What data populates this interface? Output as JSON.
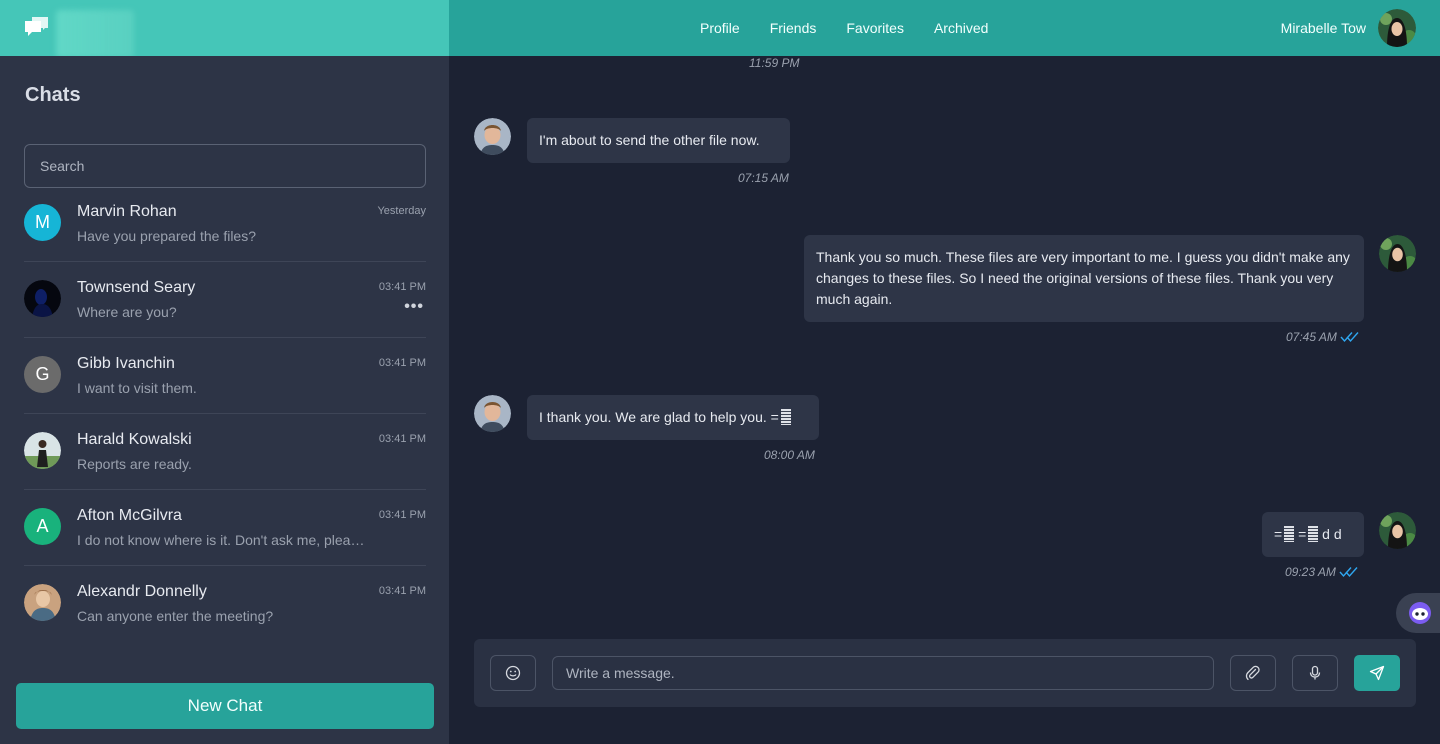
{
  "header": {
    "nav": [
      "Profile",
      "Friends",
      "Favorites",
      "Archived"
    ],
    "user_name": "Mirabelle Tow",
    "accent": "#27a39a",
    "brand_color": "#45c6b8"
  },
  "sidebar": {
    "title": "Chats",
    "search_placeholder": "Search",
    "chats": [
      {
        "name": "Marvin Rohan",
        "message": "Have you prepared the files?",
        "time": "Yesterday",
        "avatar": "M",
        "avatar_color": "#16b5d6"
      },
      {
        "name": "Townsend Seary",
        "message": "Where are you?",
        "time": "03:41 PM",
        "avatar_icon": "photo-avatar",
        "more": "•••"
      },
      {
        "name": "Gibb Ivanchin",
        "message": "I want to visit them.",
        "time": "03:41 PM",
        "avatar": "G",
        "avatar_color": "#6b6b6b"
      },
      {
        "name": "Harald Kowalski",
        "message": "Reports are ready.",
        "time": "03:41 PM",
        "avatar_icon": "photo-avatar"
      },
      {
        "name": "Afton McGilvra",
        "message": "I do not know where is it. Don't ask me, please.",
        "time": "03:41 PM",
        "avatar": "A",
        "avatar_color": "#19b27c"
      },
      {
        "name": "Alexandr Donnelly",
        "message": "Can anyone enter the meeting?",
        "time": "03:41 PM",
        "avatar_icon": "photo-avatar"
      }
    ],
    "new_chat_label": "New Chat"
  },
  "conversation": {
    "top_time": "11:59 PM",
    "messages": [
      {
        "side": "in",
        "text": "I'm about to send the other file now.",
        "time": "07:15 AM"
      },
      {
        "side": "out",
        "text": "Thank you so much. These files are very important to me. I guess you didn't make any changes to these files. So I need the original versions of these files. Thank you very much again.",
        "time": "07:45 AM",
        "read": true
      },
      {
        "side": "in",
        "text": "I thank you. We are glad to help you. =",
        "time": "08:00 AM"
      },
      {
        "side": "out",
        "text_a": "=",
        "text_b": " =",
        "text_c": " d d",
        "time": "09:23 AM",
        "read": true
      }
    ]
  },
  "composer": {
    "placeholder": "Write a message.",
    "icons": [
      "smile-icon",
      "paperclip-icon",
      "microphone-icon",
      "send-icon"
    ]
  }
}
